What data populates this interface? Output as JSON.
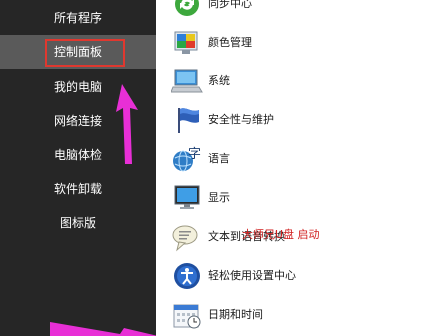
{
  "sidebar": {
    "items": [
      {
        "label": "所有程序"
      },
      {
        "label": "控制面板"
      },
      {
        "label": "我的电脑"
      },
      {
        "label": "网络连接"
      },
      {
        "label": "电脑体检"
      },
      {
        "label": "软件卸载"
      },
      {
        "label": "图标版"
      }
    ],
    "selected_index": 1,
    "highlight_color": "#e0382f"
  },
  "list": {
    "items": [
      {
        "label": "同步中心",
        "icon": "sync-center-icon"
      },
      {
        "label": "颜色管理",
        "icon": "color-management-icon"
      },
      {
        "label": "系统",
        "icon": "system-icon"
      },
      {
        "label": "安全性与维护",
        "icon": "security-flag-icon"
      },
      {
        "label": "语言",
        "icon": "language-icon"
      },
      {
        "label": "显示",
        "icon": "display-icon"
      },
      {
        "label": "文本到语音转换",
        "icon": "text-to-speech-icon"
      },
      {
        "label": "轻松使用设置中心",
        "icon": "ease-of-access-icon"
      },
      {
        "label": "日期和时间",
        "icon": "date-time-icon"
      }
    ]
  },
  "watermark": "大师兄U盘 启动",
  "annotation_color": "#e82fd6"
}
